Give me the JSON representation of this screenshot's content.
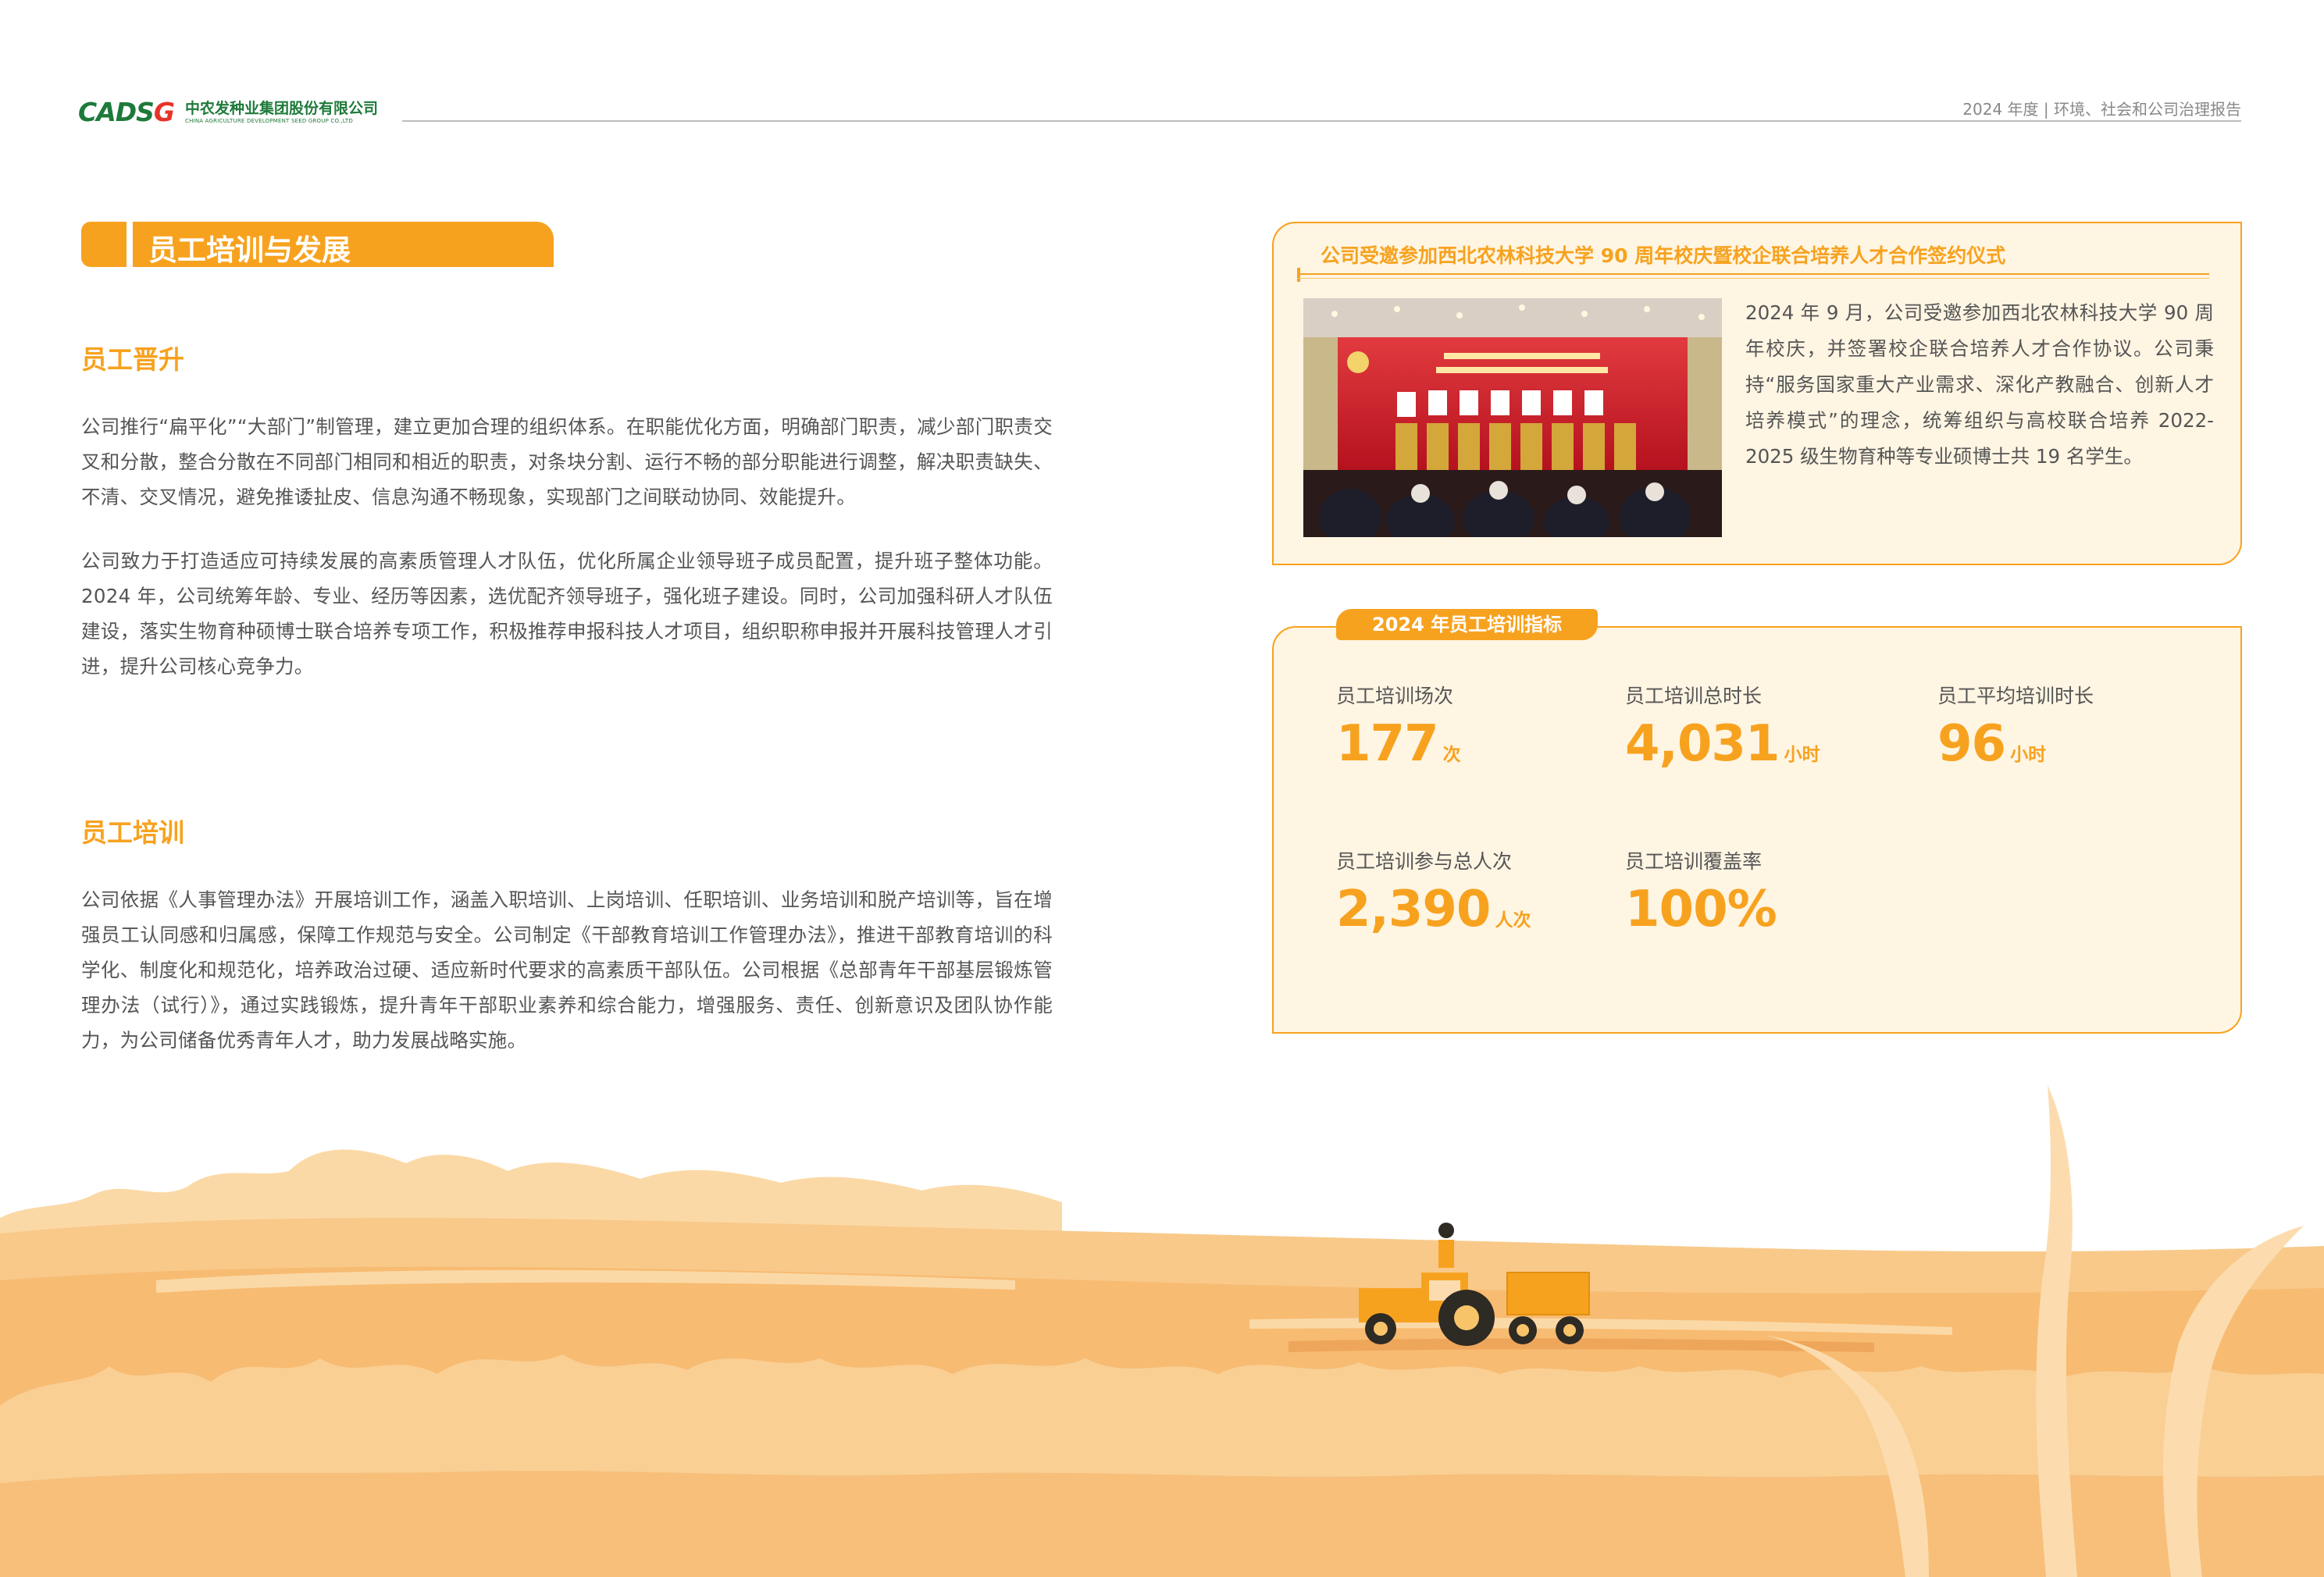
{
  "header": {
    "logo_mark_a": "CADS",
    "logo_mark_b": "G",
    "logo_cn": "中农发种业集团股份有限公司",
    "logo_en": "CHINA AGRICULTURE DEVELOPMENT SEED GROUP CO.,LTD",
    "report_title": "2024 年度 | 环境、社会和公司治理报告"
  },
  "section": {
    "title": "员工培训与发展",
    "promotion": {
      "heading": "员工晋升",
      "paragraphs": [
        "公司推行“扁平化”“大部门”制管理，建立更加合理的组织体系。在职能优化方面，明确部门职责，减少部门职责交叉和分散，整合分散在不同部门相同和相近的职责，对条块分割、运行不畅的部分职能进行调整，解决职责缺失、不清、交叉情况，避免推诿扯皮、信息沟通不畅现象，实现部门之间联动协同、效能提升。",
        "公司致力于打造适应可持续发展的高素质管理人才队伍，优化所属企业领导班子成员配置，提升班子整体功能。2024 年，公司统筹年龄、专业、经历等因素，选优配齐领导班子，强化班子建设。同时，公司加强科研人才队伍建设，落实生物育种硕博士联合培养专项工作，积极推荐申报科技人才项目，组织职称申报并开展科技管理人才引进，提升公司核心竞争力。"
      ]
    },
    "training": {
      "heading": "员工培训",
      "paragraph": "公司依据《人事管理办法》开展培训工作，涵盖入职培训、上岗培训、任职培训、业务培训和脱产培训等，旨在增强员工认同感和归属感，保障工作规范与安全。公司制定《干部教育培训工作管理办法》，推进干部教育培训的科学化、制度化和规范化，培养政治过硬、适应新时代要求的高素质干部队伍。公司根据《总部青年干部基层锻炼管理办法（试行）》，通过实践锻炼，提升青年干部职业素养和综合能力，增强服务、责任、创新意识及团队协作能力，为公司储备优秀青年人才，助力发展战略实施。"
    }
  },
  "event": {
    "title": "公司受邀参加西北农林科技大学 90 周年校庆暨校企联合培养人才合作签约仪式",
    "text": "2024 年 9 月，公司受邀参加西北农林科技大学 90 周年校庆，并签署校企联合培养人才合作协议。公司秉持“服务国家重大产业需求、深化产教融合、创新人才培养模式”的理念，统筹组织与高校联合培养 2022-2025 级生物育种等专业硕博士共 19 名学生。"
  },
  "kpis": {
    "tag": "2024 年员工培训指标",
    "items": [
      {
        "label": "员工培训场次",
        "value": "177",
        "unit": "次"
      },
      {
        "label": "员工培训总时长",
        "value": "4,031",
        "unit": "小时"
      },
      {
        "label": "员工平均培训时长",
        "value": "96",
        "unit": "小时"
      },
      {
        "label": "员工培训参与总人次",
        "value": "2,390",
        "unit": "人次"
      },
      {
        "label": "员工培训覆盖率",
        "value": "100%",
        "unit": ""
      }
    ]
  },
  "colors": {
    "accent": "#f7a21f",
    "brand_green": "#1e7a3a",
    "panel_bg": "#fff5e3"
  }
}
